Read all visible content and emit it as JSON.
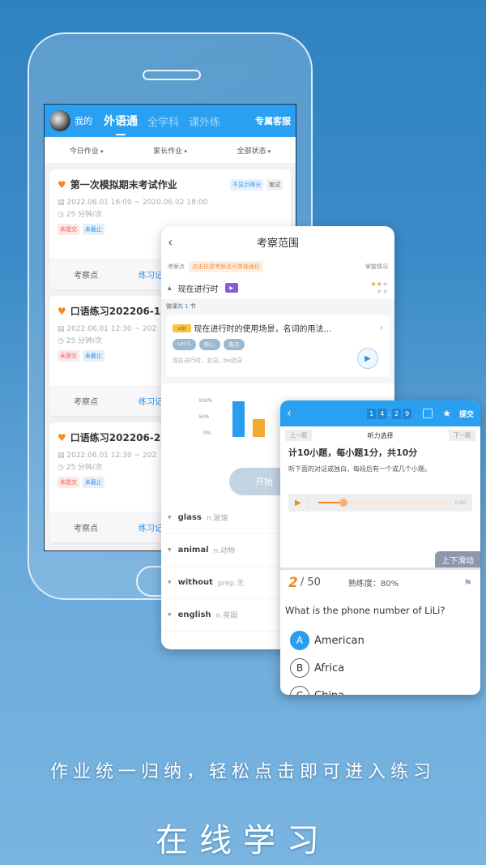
{
  "phone1": {
    "topbar": {
      "me": "我的",
      "tabs": [
        "外语通",
        "全学科",
        "课外练"
      ],
      "active_tab": 0,
      "service": "专属客服"
    },
    "filters": [
      "今日作业",
      "家长作业",
      "全部状态"
    ],
    "cards": [
      {
        "title": "第一次模拟期末考试作业",
        "tags": [
          "不显示得分",
          "笔试"
        ],
        "date": "2022.06.01 16:00 ~ 2020.06.02 18:00",
        "duration": "25 分钟/次",
        "badges": [
          "未提交",
          "未截止"
        ],
        "footer": [
          "考察点",
          "练习记"
        ]
      },
      {
        "title": "口语练习202206-1",
        "date": "2022.06.01 12:30 ~ 202",
        "duration": "25 分钟/次",
        "badges": [
          "未提交",
          "未截止"
        ],
        "footer": [
          "考察点",
          "练习记"
        ]
      },
      {
        "title": "口语练习202206-2",
        "date": "2022.06.01 12:30 ~ 202",
        "duration": "25 分钟/次",
        "badges": [
          "未提交",
          "未截止"
        ],
        "footer": [
          "考察点",
          "练习记"
        ]
      }
    ]
  },
  "panel2": {
    "title": "考察范围",
    "label": "考察点",
    "hint": "点击任意考察点可单独强化",
    "mastery": "掌握情况",
    "topic": "现在进行时",
    "stars": {
      "filled": 2,
      "total": 5
    },
    "course_count_prefix": "微课共",
    "course_count": "1",
    "course_count_suffix": "节",
    "course": {
      "vip": "vip",
      "title": "现在进行时的使用场景，名词的用法...",
      "pills": [
        "Lev1",
        "核心",
        "难点"
      ],
      "keywords": "现在进行时，名词，be动词"
    },
    "chart_labels": [
      "100%",
      "50%",
      "0%"
    ],
    "chart_values": [
      1.0,
      0.5
    ],
    "start_button": "开始",
    "words": [
      {
        "word": "glass",
        "meaning": "n.玻璃"
      },
      {
        "word": "animal",
        "meaning": "n.动物"
      },
      {
        "word": "without",
        "meaning": "prep.无"
      },
      {
        "word": "english",
        "meaning": "n.英国"
      }
    ]
  },
  "panel3": {
    "timer": [
      "1",
      "4",
      "2",
      "9"
    ],
    "submit": "提交",
    "prev": "上一题",
    "next": "下一题",
    "section": "听力选择",
    "q_summary": "计10小题，每小题1分，共10分",
    "q_instruction": "听下面的对话或独白，每段后有一个或几个小题。",
    "audio_time": "0:00",
    "audio_progress": 0.2,
    "slide_hint": "上下滑动",
    "current": "2",
    "total": "/ 50",
    "proficiency": "熟练度：80%",
    "question": "What is the phone number of LiLi?",
    "options": [
      {
        "key": "A",
        "text": "American",
        "selected": true
      },
      {
        "key": "B",
        "text": "Africa",
        "selected": false
      },
      {
        "key": "C",
        "text": "China",
        "selected": false
      }
    ]
  },
  "captions": {
    "subtitle": "作业统一归纳，轻松点击即可进入练习",
    "title": "在线学习"
  }
}
